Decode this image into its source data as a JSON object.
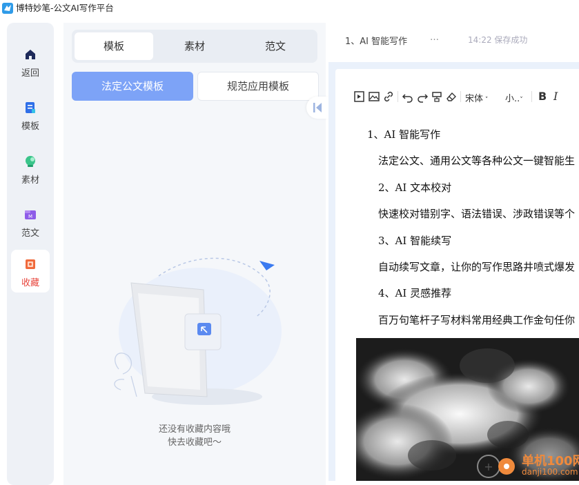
{
  "window": {
    "title": "博特妙笔-公文AI写作平台"
  },
  "nav": {
    "items": [
      {
        "label": "返回",
        "icon": "home-icon"
      },
      {
        "label": "模板",
        "icon": "template-icon"
      },
      {
        "label": "素材",
        "icon": "material-icon"
      },
      {
        "label": "范文",
        "icon": "sample-icon"
      },
      {
        "label": "收藏",
        "icon": "favorites-icon",
        "active": true
      }
    ]
  },
  "panel": {
    "tabs": [
      "模板",
      "素材",
      "范文"
    ],
    "active_tab": "模板",
    "subtabs": [
      "法定公文模板",
      "规范应用模板"
    ],
    "active_subtab": "法定公文模板",
    "empty_line1": "还没有收藏内容哦",
    "empty_line2": "快去收藏吧～"
  },
  "document": {
    "title": "1、AI 智能写作",
    "more": "…",
    "save_status": "14:22 保存成功"
  },
  "toolbar": {
    "font": "宋体",
    "size": "小..",
    "bold": "B",
    "italic": "I"
  },
  "content": [
    "1、AI 智能写作",
    "法定公文、通用公文等各种公文一键智能生",
    "2、AI 文本校对",
    "快速校对错别字、语法错误、涉政错误等个",
    "3、AI 智能续写",
    "自动续写文章，让你的写作思路井喷式爆发",
    "4、AI 灵感推荐",
    "百万句笔杆子写材料常用经典工作金句任你"
  ],
  "watermark": {
    "line1": "单机100网",
    "line2": "danji100.com"
  },
  "colors": {
    "accent": "#7da3f7",
    "active_nav": "#e8453c",
    "panel_bg": "#f5f7fa"
  }
}
